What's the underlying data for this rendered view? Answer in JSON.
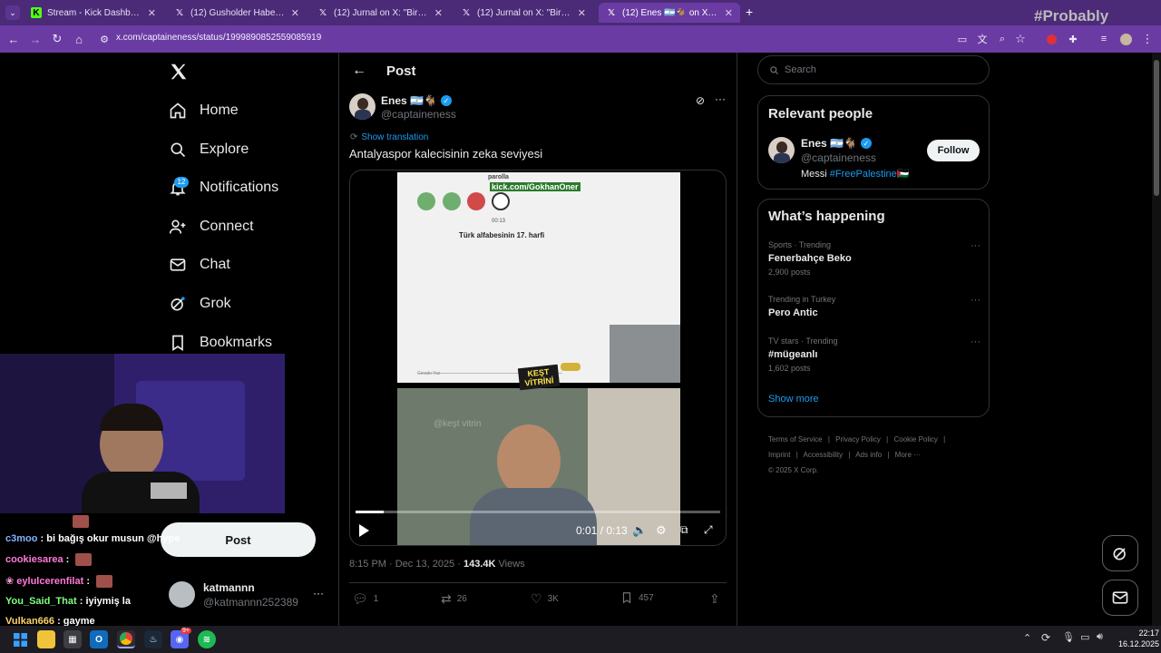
{
  "browser": {
    "tabs": [
      {
        "title": "Stream - Kick Dashboard",
        "icon": "kick-icon",
        "active": false
      },
      {
        "title": "(12) Gusholder Haber Bülteni on X",
        "icon": "x-icon",
        "active": false
      },
      {
        "title": "(12) Jurnal on X: \"Bir erkeğin, kı",
        "icon": "x-icon",
        "active": false
      },
      {
        "title": "(12) Jurnal on X: \"Bir erkeğin ot",
        "icon": "x-icon",
        "active": false
      },
      {
        "title": "(12) Enes 🇦🇷🐐 on X: \"Antalyas",
        "icon": "x-icon",
        "active": true
      }
    ],
    "new_tab": "+",
    "url": "x.com/captaineness/status/1999890852559085919",
    "probably_watermark": "#Probably"
  },
  "nav": {
    "items": [
      {
        "label": "Home",
        "icon": "home-icon"
      },
      {
        "label": "Explore",
        "icon": "search-icon"
      },
      {
        "label": "Notifications",
        "icon": "bell-icon",
        "badge": "12"
      },
      {
        "label": "Connect",
        "icon": "person-add-icon"
      },
      {
        "label": "Chat",
        "icon": "mail-icon"
      },
      {
        "label": "Grok",
        "icon": "grok-icon"
      },
      {
        "label": "Bookmarks",
        "icon": "bookmark-icon"
      }
    ],
    "post_button": "Post",
    "account": {
      "name": "katmannn",
      "handle": "@katmannn252389",
      "more": "···"
    }
  },
  "post": {
    "header_title": "Post",
    "author_name": "Enes 🇦🇷🐐",
    "author_handle": "@captaineness",
    "show_translation": "Show translation",
    "text": "Antalyaspor kalecisinin zeka seviyesi",
    "video": {
      "overlay_url": "kick.com/GokhanOner",
      "game_header": "parolla",
      "timer": "00:13",
      "question": "Türk alfabesinin 17. harfi",
      "input_placeholder": "Cevabı Yaz",
      "sticker": "KEŞT VİTRİNİ",
      "watermark": "@keşt vitrin",
      "time_display": "0:01 / 0:13",
      "progress": 0.077
    },
    "meta_time": "8:15 PM · Dec 13, 2025 · ",
    "views_count": "143.4K",
    "views_label": "Views",
    "actions": {
      "replies": "1",
      "reposts": "26",
      "likes": "3K",
      "bookmarks": "457"
    }
  },
  "sidebar": {
    "search_placeholder": "Search",
    "relevant": {
      "heading": "Relevant people",
      "name": "Enes 🇦🇷🐐",
      "handle": "@captaineness",
      "bio_prefix": "Messi ",
      "bio_link": "#FreePalestine",
      "bio_suffix": "🇵🇸",
      "follow": "Follow"
    },
    "happening": {
      "heading": "What’s happening",
      "trends": [
        {
          "context": "Sports · Trending",
          "name": "Fenerbahçe Beko",
          "count": "2,900 posts"
        },
        {
          "context": "Trending in Turkey",
          "name": "Pero Antic",
          "count": ""
        },
        {
          "context": "TV stars · Trending",
          "name": "#mügeanlı",
          "count": "1,602 posts"
        }
      ],
      "show_more": "Show more"
    },
    "footer": {
      "links1": [
        "Terms of Service",
        "Privacy Policy",
        "Cookie Policy"
      ],
      "links2": [
        "Imprint",
        "Accessibility",
        "Ads info",
        "More ···"
      ],
      "copyright": "© 2025 X Corp."
    }
  },
  "stream_overlay": {
    "chat": [
      {
        "user": "",
        "msg": "",
        "color": "#ff6b6b"
      },
      {
        "user": "c3moo",
        "msg": "bi bağış okur musun @hype",
        "color": "#7fb3ff"
      },
      {
        "user": "cookiesarea",
        "msg": "",
        "color": "#ff7ad9"
      },
      {
        "user": "eylulcerenfilat",
        "msg": "",
        "color": "#ff7ad9"
      },
      {
        "user": "You_Said_That",
        "msg": "iyiymiş la",
        "color": "#7dff7d"
      },
      {
        "user": "Vulkan666",
        "msg": "gayme",
        "color": "#ffd36b"
      }
    ]
  },
  "taskbar": {
    "time": "22:17",
    "date": "16.12.2025",
    "discord_badge": "9+"
  }
}
